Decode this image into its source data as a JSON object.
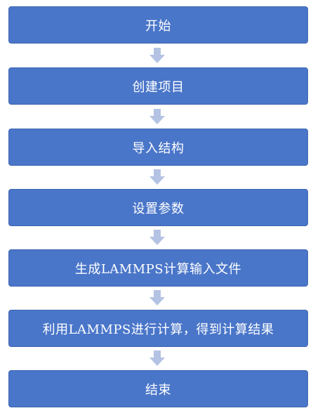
{
  "flowchart": {
    "steps": [
      {
        "label": "开始"
      },
      {
        "label": "创建项目"
      },
      {
        "label": "导入结构"
      },
      {
        "label": "设置参数"
      },
      {
        "label": "生成LAMMPS计算输入文件"
      },
      {
        "label": "利用LAMMPS进行计算，得到计算结果"
      },
      {
        "label": "结束"
      }
    ],
    "colors": {
      "box": "#4a76c9",
      "box_text": "#ffffff",
      "arrow": "#b4c3e3"
    }
  }
}
